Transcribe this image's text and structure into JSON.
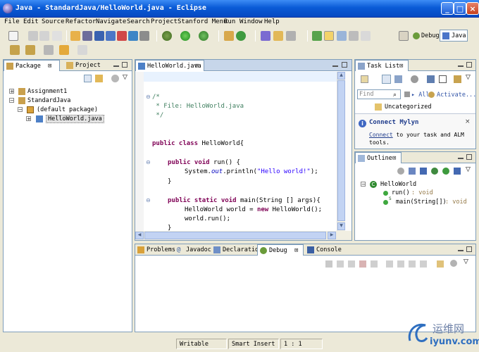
{
  "window": {
    "title": "Java - StandardJava/HelloWorld.java - Eclipse"
  },
  "menu": [
    "File",
    "Edit",
    "Source",
    "Refactor",
    "Navigate",
    "Search",
    "Project",
    "Stanford Menu",
    "Run",
    "Window",
    "Help"
  ],
  "perspectives": {
    "debug": "Debug",
    "java": "Java"
  },
  "package_explorer": {
    "tabs": {
      "package": "Package",
      "project": "Project"
    },
    "tree": {
      "project1": "Assignment1",
      "project2": "StandardJava",
      "package": "(default package)",
      "file": "HelloWorld.java"
    }
  },
  "editor": {
    "tab": "HelloWorld.java",
    "lines": {
      "l1": "/*",
      "l2": " * File: HelloWorld.java",
      "l3": " */",
      "l5_kw": "public class",
      "l5_rest": " HelloWorld{",
      "l7_kw": "public void",
      "l7_rest": " run() {",
      "l8_a": "System.",
      "l8_field": "out",
      "l8_b": ".println(",
      "l8_str": "\"Hello world!\"",
      "l8_c": ");",
      "l9": "}",
      "l11_kw": "public static void",
      "l11_rest": " main(String [] args){",
      "l12_a": "HelloWorld world = ",
      "l12_kw": "new",
      "l12_b": " HelloWorld();",
      "l13": "world.run();",
      "l14": "}"
    }
  },
  "task_list": {
    "tab": "Task List",
    "find_placeholder": "Find",
    "all": "All",
    "activate": "Activate...",
    "category": "Uncategorized",
    "connect_title": "Connect Mylyn",
    "connect_link": "Connect",
    "connect_text": " to your task and ALM tools."
  },
  "outline": {
    "tab": "Outline",
    "class": "HelloWorld",
    "method1": "run()",
    "method1_type": " : void",
    "method2": "main(String[])",
    "method2_type": " : void",
    "static_marker": "S"
  },
  "bottom_tabs": {
    "problems": "Problems",
    "javadoc": "Javadoc",
    "declaration": "Declaration",
    "debug": "Debug",
    "console": "Console"
  },
  "status": {
    "writable": "Writable",
    "insert": "Smart Insert",
    "position": "1 : 1"
  },
  "watermark": {
    "text1": "运维网",
    "text2": "iyunv.com"
  }
}
